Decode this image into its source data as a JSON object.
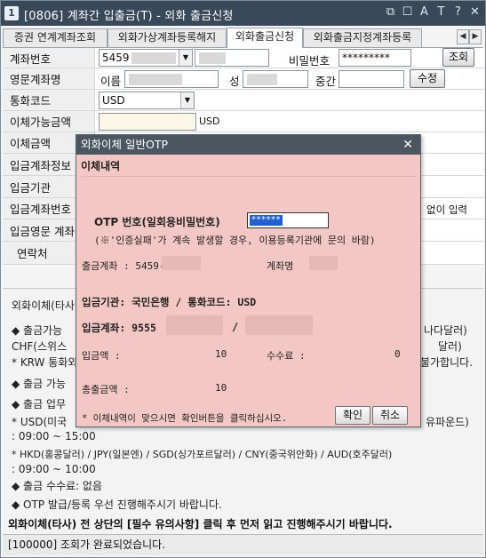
{
  "window": {
    "badge": "1",
    "title": "[0806] 계좌간 입출금(T) - 외화 출금신청",
    "controls": [
      "⧉",
      "☐",
      "A",
      "T",
      "?",
      "✕"
    ]
  },
  "tabs": [
    {
      "label": "증권 연계계좌조회"
    },
    {
      "label": "외화가상계좌등록해지"
    },
    {
      "label": "외화출금신청"
    },
    {
      "label": "외화출금지정계좌등록"
    }
  ],
  "tab_nav": {
    "prev": "◀",
    "next": "▶"
  },
  "form": {
    "account_label": "계좌번호",
    "account_value": "5459",
    "password_label": "비밀번호",
    "password_value": "*********",
    "lookup_button": "조회",
    "eng_name_label": "영문계좌명",
    "first_name_label": "이름",
    "last_name_label": "성",
    "middle_name_label": "중간",
    "edit_button": "수정",
    "currency_label": "통화코드",
    "currency_value": "USD",
    "available_label": "이체가능금액",
    "available_unit": "USD",
    "transfer_label": "이체금액",
    "in_account_info_label": "입금계좌정보",
    "in_bank_label": "입금기관",
    "in_account_label": "입금계좌번호",
    "direct_input": "없이 입력",
    "in_eng_name_label": "입금영문 계좌명",
    "contact_label": "연락처"
  },
  "info": {
    "lines": [
      "외화이체(타사",
      "◆ 출금가능",
      "  CHF(스위스",
      "  * KRW 통화외",
      "◆ 출금 가능",
      "◆ 출금 업무",
      "  * USD(미국",
      "    : 09:00 ~ 15:00",
      "  * HKD(홍콩달러) / JPY(일본엔) / SGD(싱가포르달러) / CNY(중국위안화) / AUD(호주달러)",
      "    : 09:00 ~ 10:00",
      "◆ 출금 수수료: 없음",
      "◆ OTP 발급/등록 우선 진행해주시기 바랍니다."
    ],
    "right_fragments": [
      "나다달러)",
      "달러)",
      "불가합니다.",
      "유파운드)"
    ],
    "warning": "외화이체(타사) 전 상단의 [필수 유의사항] 클릭 후 먼저 읽고 진행해주시기 바랍니다."
  },
  "status": "[100000] 조회가 완료되었습니다.",
  "dialog": {
    "title": "외화이체 일반OTP",
    "section": "이체내역",
    "otp_label": "OTP 번호(일회용비밀번호)",
    "otp_value": "******",
    "otp_note": "(※'인증실패'가 계속 발생할 경우, 이용등록기관에 문의 바람)",
    "out_account_label": "출금계좌 : 5459-",
    "account_name_label": "계좌명",
    "in_bank_line": "입금기관: 국민은행  /  통화코드: USD",
    "in_account_line": "입금계좌: 9555",
    "in_account_sep": "/",
    "amount_label": "입금액   :",
    "amount_value": "10",
    "fee_label": "수수료 :",
    "fee_value": "0",
    "total_label": "총출금액 :",
    "total_value": "10",
    "confirm_note": "* 이체내역이 맞으시면 확인버튼을 클릭하십시오.",
    "ok_button": "확인",
    "cancel_button": "취소",
    "close": "✕"
  }
}
